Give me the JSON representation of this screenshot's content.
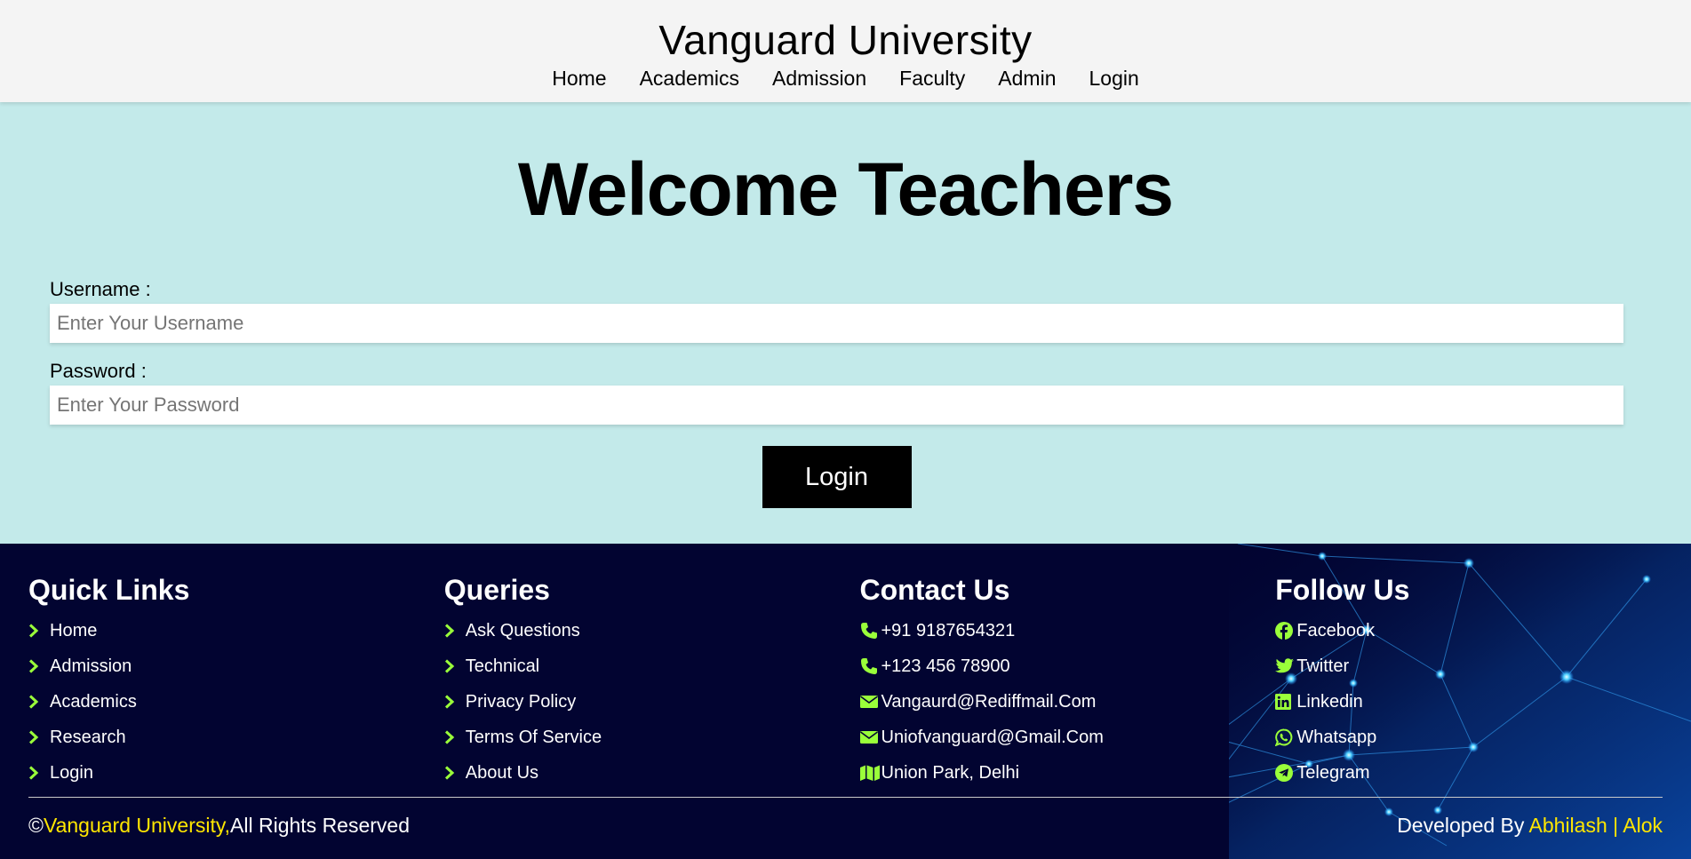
{
  "header": {
    "title": "Vanguard University",
    "nav": [
      "Home",
      "Academics",
      "Admission",
      "Faculty",
      "Admin",
      "Login"
    ]
  },
  "main": {
    "heading": "Welcome Teachers",
    "username_label": "Username :",
    "username_placeholder": "Enter Your Username",
    "password_label": "Password :",
    "password_placeholder": "Enter Your Password",
    "login_button": "Login"
  },
  "footer": {
    "quick_links": {
      "title": "Quick Links",
      "items": [
        "Home",
        "Admission",
        "Academics",
        "Research",
        "Login"
      ]
    },
    "queries": {
      "title": "Queries",
      "items": [
        "Ask Questions",
        "Technical",
        "Privacy Policy",
        "Terms Of Service",
        "About Us"
      ]
    },
    "contact": {
      "title": "Contact Us",
      "items": [
        {
          "icon": "phone-icon",
          "text": "+91 9187654321"
        },
        {
          "icon": "phone-icon",
          "text": "+123 456 78900"
        },
        {
          "icon": "envelope-icon",
          "text": "Vangaurd@Rediffmail.Com"
        },
        {
          "icon": "envelope-icon",
          "text": "Uniofvanguard@Gmail.Com"
        },
        {
          "icon": "map-icon",
          "text": "Union Park, Delhi"
        }
      ]
    },
    "follow": {
      "title": "Follow Us",
      "items": [
        {
          "icon": "facebook-icon",
          "text": "Facebook"
        },
        {
          "icon": "twitter-icon",
          "text": "Twitter"
        },
        {
          "icon": "linkedin-icon",
          "text": "Linkedin"
        },
        {
          "icon": "whatsapp-icon",
          "text": "Whatsapp"
        },
        {
          "icon": "telegram-icon",
          "text": "Telegram"
        }
      ]
    },
    "copyright_symbol": "©",
    "copyright_name": "Vanguard University,",
    "copyright_rest": "All Rights Reserved",
    "developed_by": "Developed By ",
    "developer1": "Abhilash",
    "separator": " | ",
    "developer2": "Alok"
  },
  "colors": {
    "page_bg": "#c3eaea",
    "header_bg": "#f4f4f4",
    "footer_bg": "#020431",
    "icon_accent": "#9aff3a",
    "highlight": "#ffe600"
  }
}
